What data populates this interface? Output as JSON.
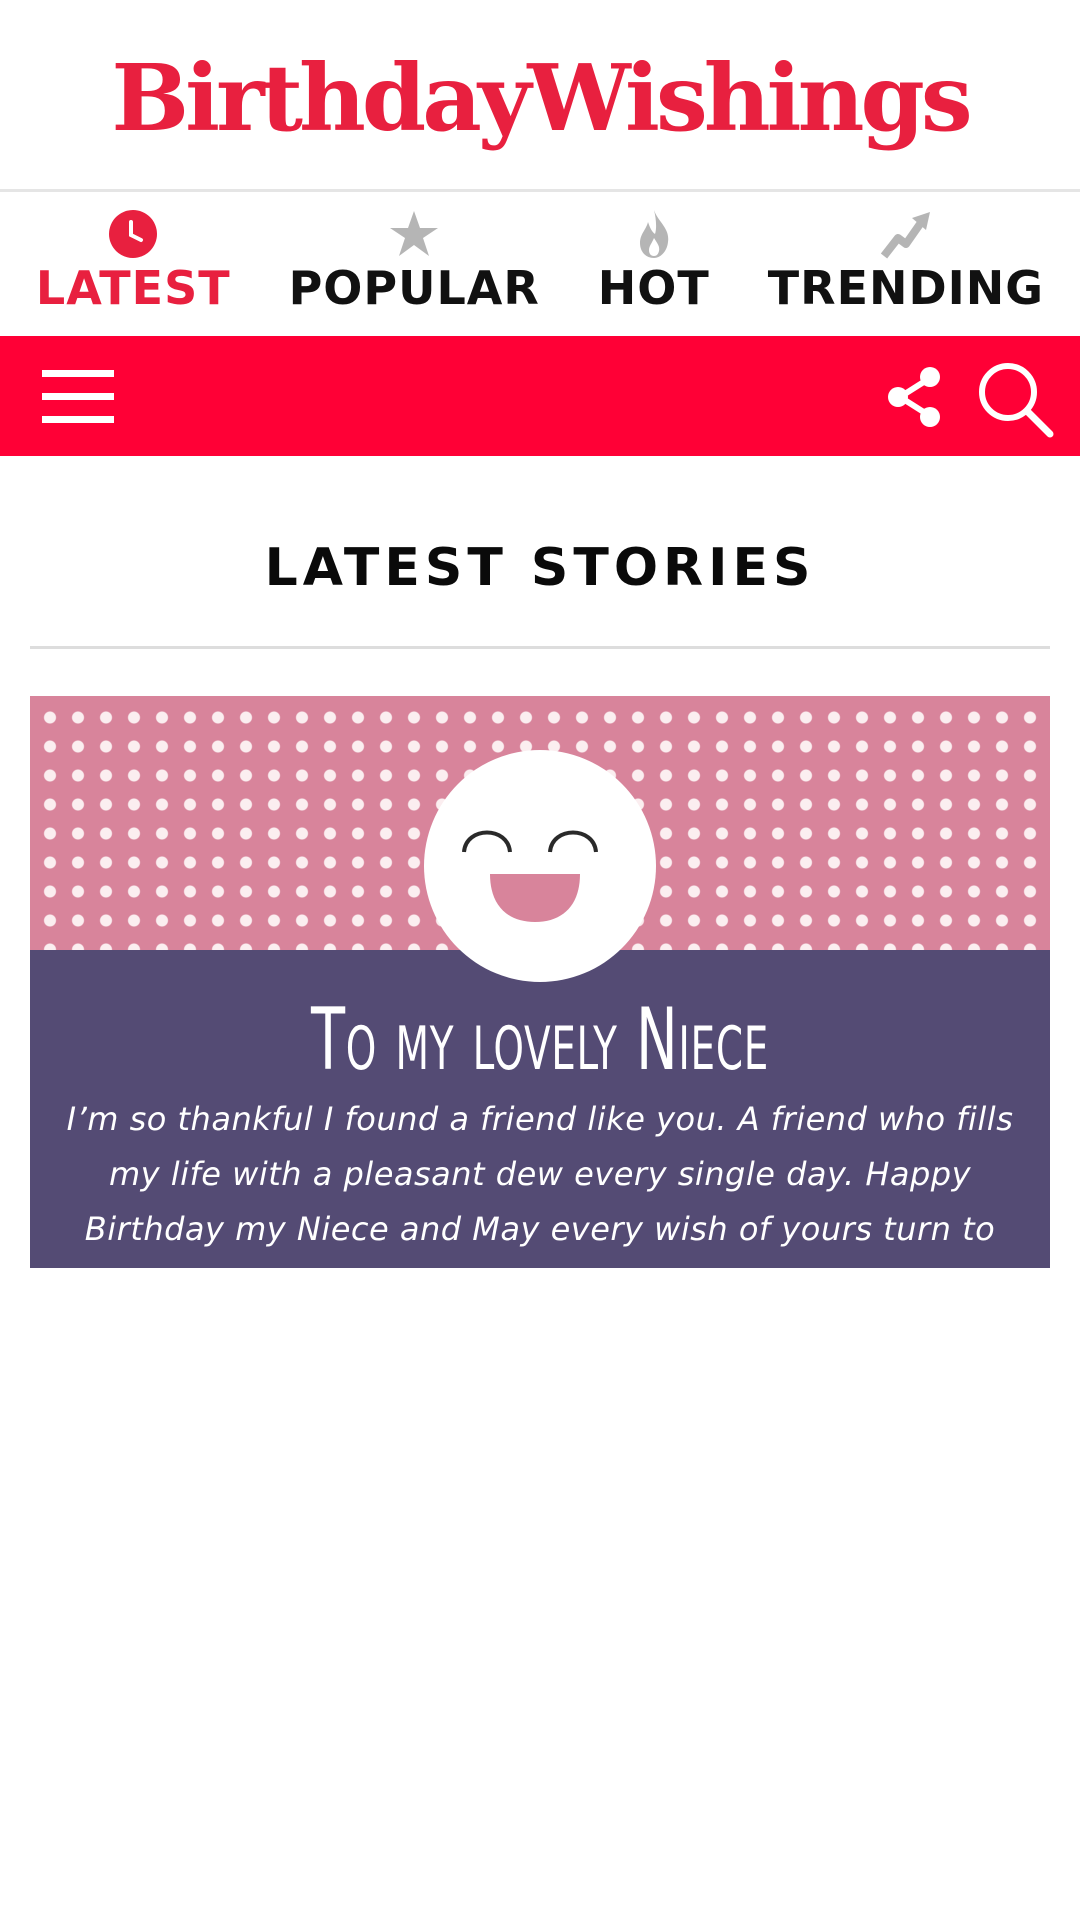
{
  "header": {
    "logo_text": "BirthdayWishings"
  },
  "tabs": [
    {
      "label": "LATEST",
      "icon": "clock-icon",
      "active": true
    },
    {
      "label": "POPULAR",
      "icon": "star-icon",
      "active": false
    },
    {
      "label": "HOT",
      "icon": "flame-icon",
      "active": false
    },
    {
      "label": "TRENDING",
      "icon": "trending-arrow-icon",
      "active": false
    }
  ],
  "toolbar": {
    "menu_icon": "hamburger-menu-icon",
    "share_icon": "share-icon",
    "search_icon": "search-icon",
    "background_color": "#ff0036"
  },
  "main": {
    "section_title": "LATEST STORIES",
    "stories": [
      {
        "heading": "To my lovely Niece",
        "message": "I’m so thankful I found a friend like you. A friend who fills my life with a pleasant dew every single day. Happy Birthday my Niece and May every wish of yours turn to reality.",
        "image_icon": "smiley-face-icon"
      }
    ]
  },
  "colors": {
    "brand": "#e8203f",
    "card_pink": "#d8849b",
    "card_purple": "#544b74",
    "inactive_icon": "#b5b5b5"
  }
}
